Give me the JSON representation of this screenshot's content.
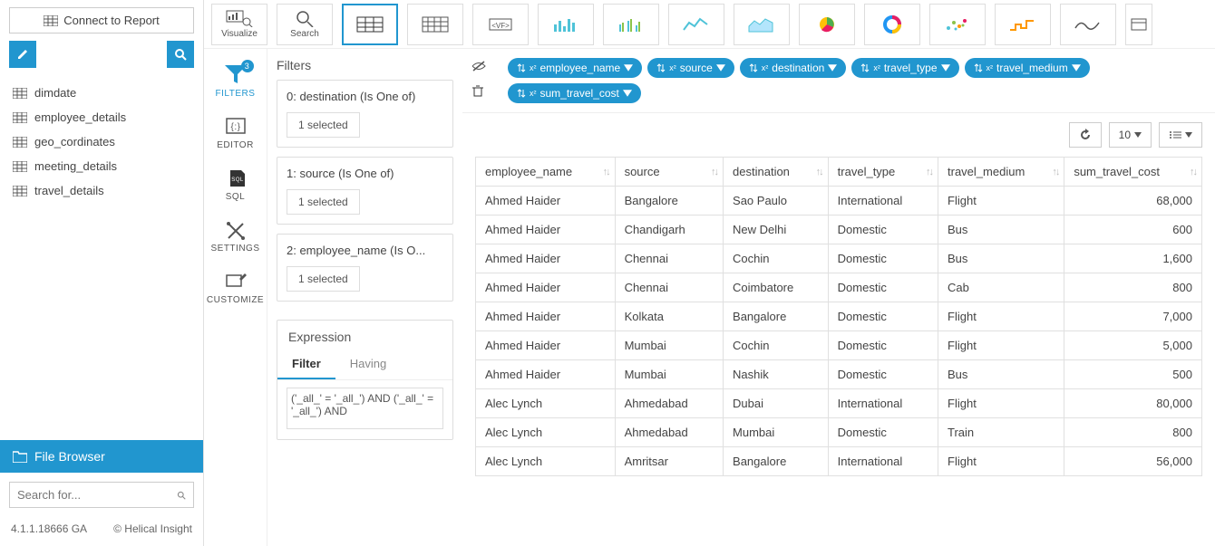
{
  "connect_label": "Connect to Report",
  "tables": [
    "dimdate",
    "employee_details",
    "geo_cordinates",
    "meeting_details",
    "travel_details"
  ],
  "file_browser_label": "File Browser",
  "search_placeholder": "Search for...",
  "version": "4.1.1.18666 GA",
  "copyright": "© Helical Insight",
  "top_tools": {
    "visualize": "Visualize",
    "search": "Search"
  },
  "vtabs": {
    "filters": "FILTERS",
    "editor": "EDITOR",
    "sql": "SQL",
    "settings": "SETTINGS",
    "customize": "CUSTOMIZE",
    "filter_badge": "3"
  },
  "filters": {
    "title": "Filters",
    "items": [
      {
        "label": "0: destination (Is One of)",
        "selected": "1 selected"
      },
      {
        "label": "1: source (Is One of)",
        "selected": "1 selected"
      },
      {
        "label": "2: employee_name (Is O...",
        "selected": "1 selected"
      }
    ],
    "expr_title": "Expression",
    "expr_tab_filter": "Filter",
    "expr_tab_having": "Having",
    "expr_body": "('_all_' = '_all_') AND ('_all_' = '_all_') AND"
  },
  "pills": [
    "employee_name",
    "source",
    "destination",
    "travel_type",
    "travel_medium",
    "sum_travel_cost"
  ],
  "page_size": "10",
  "columns": [
    "employee_name",
    "source",
    "destination",
    "travel_type",
    "travel_medium",
    "sum_travel_cost"
  ],
  "rows": [
    [
      "Ahmed Haider",
      "Bangalore",
      "Sao Paulo",
      "International",
      "Flight",
      "68,000"
    ],
    [
      "Ahmed Haider",
      "Chandigarh",
      "New Delhi",
      "Domestic",
      "Bus",
      "600"
    ],
    [
      "Ahmed Haider",
      "Chennai",
      "Cochin",
      "Domestic",
      "Bus",
      "1,600"
    ],
    [
      "Ahmed Haider",
      "Chennai",
      "Coimbatore",
      "Domestic",
      "Cab",
      "800"
    ],
    [
      "Ahmed Haider",
      "Kolkata",
      "Bangalore",
      "Domestic",
      "Flight",
      "7,000"
    ],
    [
      "Ahmed Haider",
      "Mumbai",
      "Cochin",
      "Domestic",
      "Flight",
      "5,000"
    ],
    [
      "Ahmed Haider",
      "Mumbai",
      "Nashik",
      "Domestic",
      "Bus",
      "500"
    ],
    [
      "Alec Lynch",
      "Ahmedabad",
      "Dubai",
      "International",
      "Flight",
      "80,000"
    ],
    [
      "Alec Lynch",
      "Ahmedabad",
      "Mumbai",
      "Domestic",
      "Train",
      "800"
    ],
    [
      "Alec Lynch",
      "Amritsar",
      "Bangalore",
      "International",
      "Flight",
      "56,000"
    ]
  ]
}
